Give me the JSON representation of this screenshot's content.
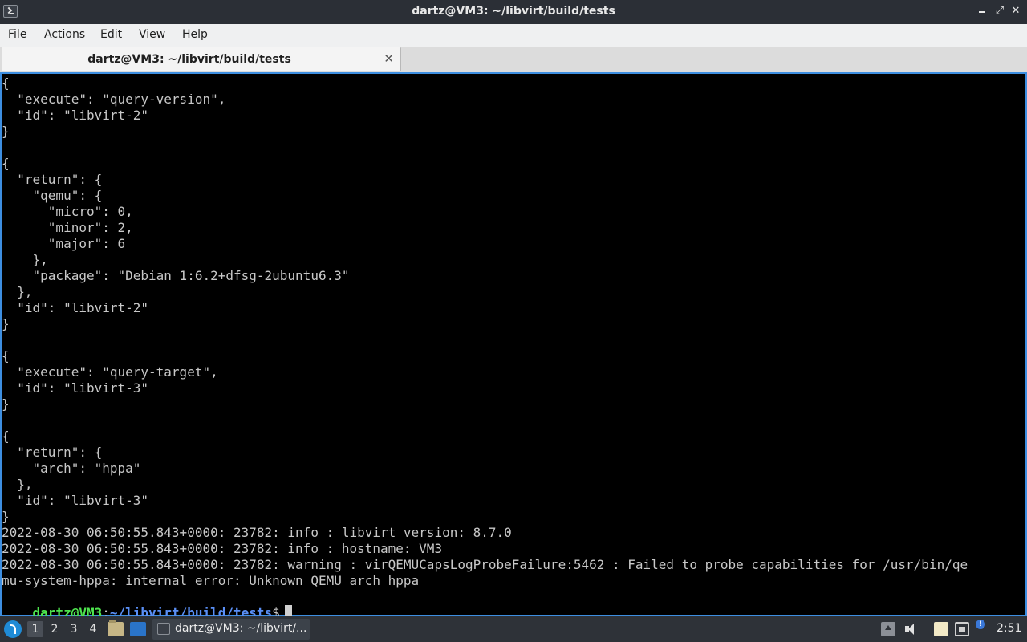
{
  "window": {
    "title": "dartz@VM3: ~/libvirt/build/tests",
    "close_glyph": "✕",
    "max_glyph": "⤢"
  },
  "menu": [
    "File",
    "Actions",
    "Edit",
    "View",
    "Help"
  ],
  "tab": {
    "label": "dartz@VM3: ~/libvirt/build/tests",
    "close_glyph": "✕"
  },
  "terminal": {
    "lines": [
      "{",
      "  \"execute\": \"query-version\",",
      "  \"id\": \"libvirt-2\"",
      "}",
      "",
      "{",
      "  \"return\": {",
      "    \"qemu\": {",
      "      \"micro\": 0,",
      "      \"minor\": 2,",
      "      \"major\": 6",
      "    },",
      "    \"package\": \"Debian 1:6.2+dfsg-2ubuntu6.3\"",
      "  },",
      "  \"id\": \"libvirt-2\"",
      "}",
      "",
      "{",
      "  \"execute\": \"query-target\",",
      "  \"id\": \"libvirt-3\"",
      "}",
      "",
      "{",
      "  \"return\": {",
      "    \"arch\": \"hppa\"",
      "  },",
      "  \"id\": \"libvirt-3\"",
      "}",
      "2022-08-30 06:50:55.843+0000: 23782: info : libvirt version: 8.7.0",
      "2022-08-30 06:50:55.843+0000: 23782: info : hostname: VM3",
      "2022-08-30 06:50:55.843+0000: 23782: warning : virQEMUCapsLogProbeFailure:5462 : Failed to probe capabilities for /usr/bin/qe",
      "mu-system-hppa: internal error: Unknown QEMU arch hppa"
    ],
    "prompt": {
      "user_host": "dartz@VM3",
      "colon": ":",
      "path": "~/libvirt/build/tests",
      "dollar": "$"
    }
  },
  "taskbar": {
    "workspaces": [
      "1",
      "2",
      "3",
      "4"
    ],
    "active_workspace": "1",
    "task_label": "dartz@VM3: ~/libvirt/...",
    "notification_badge": "!",
    "clock": "2:51"
  },
  "icons": {
    "app": "terminal-icon",
    "start": "start-menu-icon",
    "files": "file-manager-icon",
    "desktop": "show-desktop-icon",
    "volume": "volume-icon",
    "clipboard": "clipboard-icon",
    "network": "network-icon",
    "notification": "notification-icon"
  },
  "colors": {
    "terminal_bg": "#000000",
    "terminal_fg": "#c8c8c8",
    "prompt_user": "#4ee44e",
    "prompt_path": "#5a8ff5",
    "focus_border": "#3d8ee0"
  }
}
